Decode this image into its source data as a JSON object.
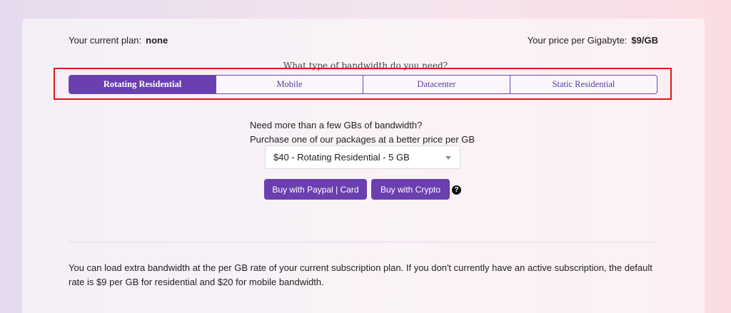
{
  "plan": {
    "current_label": "Your current plan:",
    "current_value": "none",
    "price_label": "Your price per Gigabyte:",
    "price_value": "$9/GB"
  },
  "bandwidth": {
    "question": "What type of bandwidth do you need?",
    "tabs": [
      {
        "label": "Rotating Residential",
        "active": true
      },
      {
        "label": "Mobile",
        "active": false
      },
      {
        "label": "Datacenter",
        "active": false
      },
      {
        "label": "Static Residential",
        "active": false
      }
    ]
  },
  "packages": {
    "line1": "Need more than a few GBs of bandwidth?",
    "line2": "Purchase one of our packages at a better price per GB",
    "selected": "$40 - Rotating Residential - 5 GB",
    "buy_paypal": "Buy with Paypal | Card",
    "buy_crypto": "Buy with Crypto",
    "help_glyph": "?"
  },
  "footer": {
    "text": "You can load extra bandwidth at the per GB rate of your current subscription plan. If you don't currently have an active subscription, the default rate is $9 per GB for residential and $20 for mobile bandwidth."
  },
  "colors": {
    "accent": "#6a3fb0",
    "highlight": "#e2161c"
  }
}
